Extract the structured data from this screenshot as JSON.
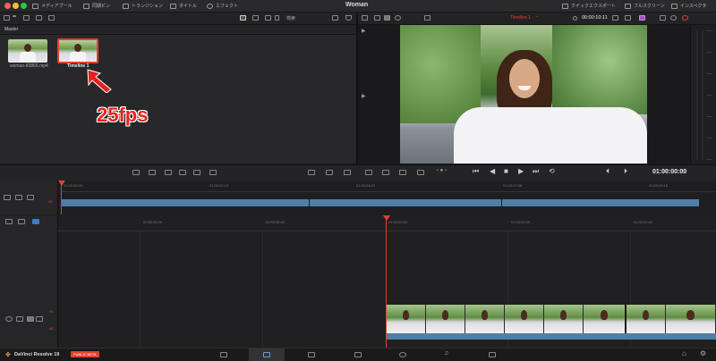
{
  "app": {
    "title": "Woman",
    "top_tabs": [
      {
        "label": "メディアプール",
        "icon": "media-pool-icon"
      },
      {
        "label": "同期ビン",
        "icon": "sync-bin-icon"
      },
      {
        "label": "トランジション",
        "icon": "transition-icon"
      },
      {
        "label": "タイトル",
        "icon": "title-icon"
      },
      {
        "label": "エフェクト",
        "icon": "effects-icon"
      }
    ],
    "right_tabs": [
      {
        "label": "クイックエクスポート",
        "icon": "quick-export-icon"
      },
      {
        "label": "フルスクリーン",
        "icon": "fullscreen-icon"
      },
      {
        "label": "インスペクタ",
        "icon": "inspector-icon"
      }
    ],
    "search_label": "検索"
  },
  "media": {
    "bin": "Master",
    "clips": [
      {
        "name": "woman-83866.mp4"
      },
      {
        "name": "Timeline 1",
        "selected": true
      }
    ],
    "annotation": "25fps"
  },
  "viewer": {
    "timeline_name": "Timeline 1",
    "timecode_top": "00:00:10:11",
    "timecode_transport": "01:00:00:00"
  },
  "mini_ruler": [
    "01:00:00:00",
    "01:00:02:19",
    "01:00:04:23",
    "01:00:07:08",
    "01:00:09:18"
  ],
  "main_ruler": [
    "01:00:06:00",
    "01:00:00:00",
    "01:00:02:00",
    "01:00:04:00"
  ],
  "left_ruler": [
    "00:59:56:00",
    "00:59:58:00"
  ],
  "tracks": {
    "video": "V1",
    "audio": "A1",
    "mini": "V1"
  },
  "footer": {
    "product": "DaVinci Resolve 19",
    "badge": "PUBLIC BETA"
  },
  "colors": {
    "accent": "#e0412f",
    "clip_blue": "#4f7ea6",
    "selected_border": "#e0412f"
  }
}
